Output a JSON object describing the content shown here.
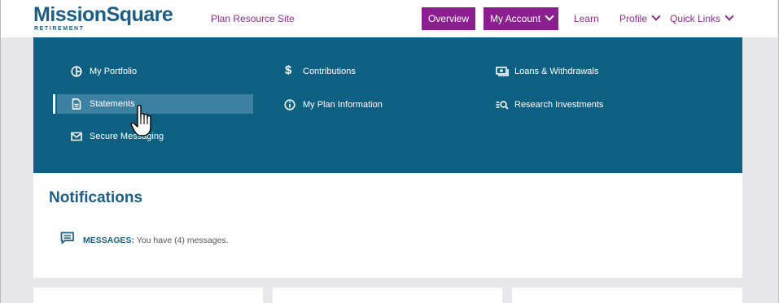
{
  "header": {
    "logo_text": "MissionSquare",
    "logo_sub": "RETIREMENT",
    "plan_link": "Plan Resource Site",
    "nav": {
      "overview": "Overview",
      "my_account": "My Account",
      "learn": "Learn",
      "profile": "Profile",
      "quick_links": "Quick Links"
    }
  },
  "menu": {
    "items": [
      {
        "label": "My Portfolio",
        "icon": "pie-chart-icon"
      },
      {
        "label": "Contributions",
        "icon": "dollar-icon"
      },
      {
        "label": "Loans & Withdrawals",
        "icon": "cash-icon"
      },
      {
        "label": "Statements",
        "icon": "document-icon",
        "active": true
      },
      {
        "label": "My Plan Information",
        "icon": "info-icon"
      },
      {
        "label": "Research Investments",
        "icon": "search-list-icon"
      },
      {
        "label": "Secure Messaging",
        "icon": "envelope-icon"
      }
    ]
  },
  "notifications": {
    "title": "Notifications",
    "message_label": "MESSAGES:",
    "message_text": "You have (4) messages."
  },
  "colors": {
    "brand_blue": "#1b5f86",
    "menu_bg": "#0e6082",
    "accent_purple": "#8b1f8f"
  }
}
